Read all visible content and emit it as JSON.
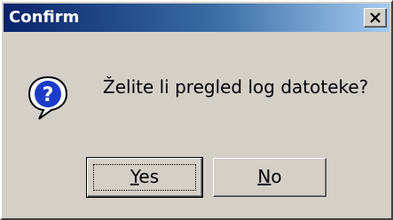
{
  "dialog": {
    "title": "Confirm",
    "message": "Želite li pregled log datoteke?",
    "icon": "question-icon"
  },
  "buttons": {
    "yes": {
      "accel": "Y",
      "rest": "es"
    },
    "no": {
      "accel": "N",
      "rest": "o"
    }
  },
  "titlebar": {
    "close_icon": "close-icon"
  }
}
